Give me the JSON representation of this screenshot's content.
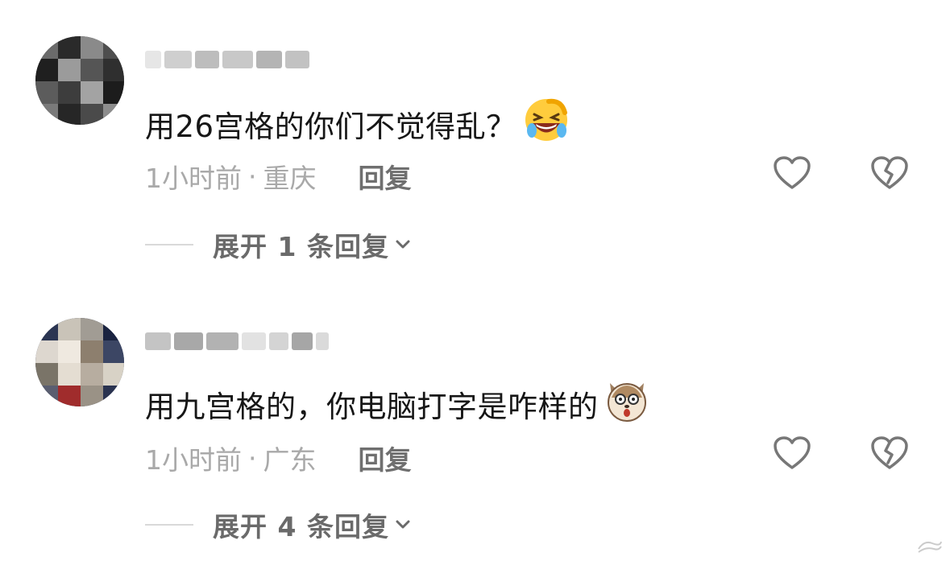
{
  "comments": [
    {
      "username": "",
      "text": "用26宫格的你们不觉得乱？",
      "emoji": "grinning-squinting-face-emoji",
      "time": "1小时前",
      "separator": "·",
      "location": "重庆",
      "reply_label": "回复",
      "expand_label": "展开 1 条回复"
    },
    {
      "username": "",
      "text": "用九宫格的，你电脑打字是咋样的",
      "emoji": "surprised-dog-face-emoji",
      "time": "1小时前",
      "separator": "·",
      "location": "广东",
      "reply_label": "回复",
      "expand_label": "展开 4 条回复"
    }
  ],
  "icons": {
    "like": "heart-outline-icon",
    "dislike": "broken-heart-outline-icon",
    "expand": "chevron-down-icon"
  },
  "colors": {
    "text": "#161616",
    "meta": "#a9a9a9",
    "reply": "#6f6f6f",
    "icon": "#777777"
  }
}
